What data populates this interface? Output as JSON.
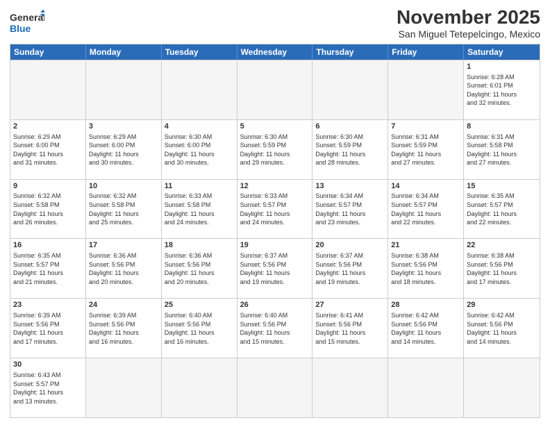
{
  "header": {
    "logo_general": "General",
    "logo_blue": "Blue",
    "title": "November 2025",
    "subtitle": "San Miguel Tetepelcingo, Mexico"
  },
  "days": [
    "Sunday",
    "Monday",
    "Tuesday",
    "Wednesday",
    "Thursday",
    "Friday",
    "Saturday"
  ],
  "weeks": [
    [
      {
        "day": "",
        "info": ""
      },
      {
        "day": "",
        "info": ""
      },
      {
        "day": "",
        "info": ""
      },
      {
        "day": "",
        "info": ""
      },
      {
        "day": "",
        "info": ""
      },
      {
        "day": "",
        "info": ""
      },
      {
        "day": "1",
        "info": "Sunrise: 6:28 AM\nSunset: 6:01 PM\nDaylight: 11 hours\nand 32 minutes."
      }
    ],
    [
      {
        "day": "2",
        "info": "Sunrise: 6:29 AM\nSunset: 6:00 PM\nDaylight: 11 hours\nand 31 minutes."
      },
      {
        "day": "3",
        "info": "Sunrise: 6:29 AM\nSunset: 6:00 PM\nDaylight: 11 hours\nand 30 minutes."
      },
      {
        "day": "4",
        "info": "Sunrise: 6:30 AM\nSunset: 6:00 PM\nDaylight: 11 hours\nand 30 minutes."
      },
      {
        "day": "5",
        "info": "Sunrise: 6:30 AM\nSunset: 5:59 PM\nDaylight: 11 hours\nand 29 minutes."
      },
      {
        "day": "6",
        "info": "Sunrise: 6:30 AM\nSunset: 5:59 PM\nDaylight: 11 hours\nand 28 minutes."
      },
      {
        "day": "7",
        "info": "Sunrise: 6:31 AM\nSunset: 5:59 PM\nDaylight: 11 hours\nand 27 minutes."
      },
      {
        "day": "8",
        "info": "Sunrise: 6:31 AM\nSunset: 5:58 PM\nDaylight: 11 hours\nand 27 minutes."
      }
    ],
    [
      {
        "day": "9",
        "info": "Sunrise: 6:32 AM\nSunset: 5:58 PM\nDaylight: 11 hours\nand 26 minutes."
      },
      {
        "day": "10",
        "info": "Sunrise: 6:32 AM\nSunset: 5:58 PM\nDaylight: 11 hours\nand 25 minutes."
      },
      {
        "day": "11",
        "info": "Sunrise: 6:33 AM\nSunset: 5:58 PM\nDaylight: 11 hours\nand 24 minutes."
      },
      {
        "day": "12",
        "info": "Sunrise: 6:33 AM\nSunset: 5:57 PM\nDaylight: 11 hours\nand 24 minutes."
      },
      {
        "day": "13",
        "info": "Sunrise: 6:34 AM\nSunset: 5:57 PM\nDaylight: 11 hours\nand 23 minutes."
      },
      {
        "day": "14",
        "info": "Sunrise: 6:34 AM\nSunset: 5:57 PM\nDaylight: 11 hours\nand 22 minutes."
      },
      {
        "day": "15",
        "info": "Sunrise: 6:35 AM\nSunset: 5:57 PM\nDaylight: 11 hours\nand 22 minutes."
      }
    ],
    [
      {
        "day": "16",
        "info": "Sunrise: 6:35 AM\nSunset: 5:57 PM\nDaylight: 11 hours\nand 21 minutes."
      },
      {
        "day": "17",
        "info": "Sunrise: 6:36 AM\nSunset: 5:56 PM\nDaylight: 11 hours\nand 20 minutes."
      },
      {
        "day": "18",
        "info": "Sunrise: 6:36 AM\nSunset: 5:56 PM\nDaylight: 11 hours\nand 20 minutes."
      },
      {
        "day": "19",
        "info": "Sunrise: 6:37 AM\nSunset: 5:56 PM\nDaylight: 11 hours\nand 19 minutes."
      },
      {
        "day": "20",
        "info": "Sunrise: 6:37 AM\nSunset: 5:56 PM\nDaylight: 11 hours\nand 19 minutes."
      },
      {
        "day": "21",
        "info": "Sunrise: 6:38 AM\nSunset: 5:56 PM\nDaylight: 11 hours\nand 18 minutes."
      },
      {
        "day": "22",
        "info": "Sunrise: 6:38 AM\nSunset: 5:56 PM\nDaylight: 11 hours\nand 17 minutes."
      }
    ],
    [
      {
        "day": "23",
        "info": "Sunrise: 6:39 AM\nSunset: 5:56 PM\nDaylight: 11 hours\nand 17 minutes."
      },
      {
        "day": "24",
        "info": "Sunrise: 6:39 AM\nSunset: 5:56 PM\nDaylight: 11 hours\nand 16 minutes."
      },
      {
        "day": "25",
        "info": "Sunrise: 6:40 AM\nSunset: 5:56 PM\nDaylight: 11 hours\nand 16 minutes."
      },
      {
        "day": "26",
        "info": "Sunrise: 6:40 AM\nSunset: 5:56 PM\nDaylight: 11 hours\nand 15 minutes."
      },
      {
        "day": "27",
        "info": "Sunrise: 6:41 AM\nSunset: 5:56 PM\nDaylight: 11 hours\nand 15 minutes."
      },
      {
        "day": "28",
        "info": "Sunrise: 6:42 AM\nSunset: 5:56 PM\nDaylight: 11 hours\nand 14 minutes."
      },
      {
        "day": "29",
        "info": "Sunrise: 6:42 AM\nSunset: 5:56 PM\nDaylight: 11 hours\nand 14 minutes."
      }
    ],
    [
      {
        "day": "30",
        "info": "Sunrise: 6:43 AM\nSunset: 5:57 PM\nDaylight: 11 hours\nand 13 minutes."
      },
      {
        "day": "",
        "info": ""
      },
      {
        "day": "",
        "info": ""
      },
      {
        "day": "",
        "info": ""
      },
      {
        "day": "",
        "info": ""
      },
      {
        "day": "",
        "info": ""
      },
      {
        "day": "",
        "info": ""
      }
    ]
  ]
}
